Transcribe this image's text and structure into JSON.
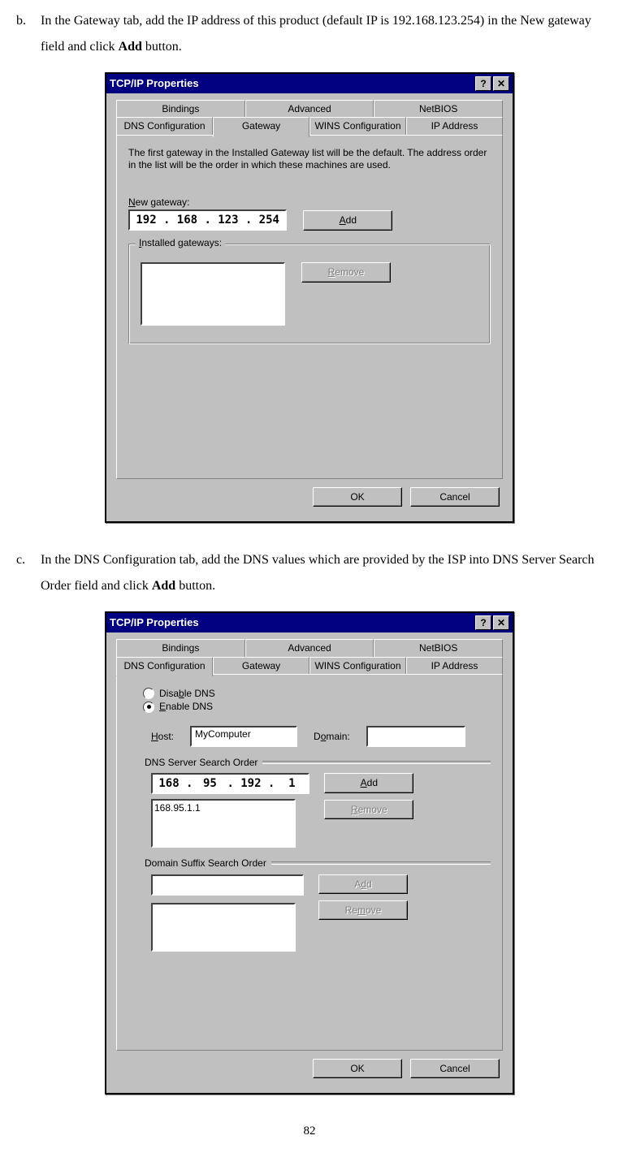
{
  "page_number": "82",
  "instruction_b": {
    "letter": "b.",
    "text_before_bold": "In the Gateway tab, add the IP address of this product (default IP is 192.168.123.254) in the New gateway field and click ",
    "bold": "Add",
    "text_after_bold": " button."
  },
  "instruction_c": {
    "letter": "c.",
    "text_before_bold": "In the DNS Configuration tab, add the DNS values which are provided by the ISP into DNS Server Search Order field and click ",
    "bold": "Add",
    "text_after_bold": " button."
  },
  "dialog1": {
    "title": "TCP/IP Properties",
    "help_btn": "?",
    "close_btn": "✕",
    "tabs_row1": [
      "Bindings",
      "Advanced",
      "NetBIOS"
    ],
    "tabs_row2": [
      "DNS Configuration",
      "Gateway",
      "WINS Configuration",
      "IP Address"
    ],
    "active_tab": "Gateway",
    "help_text": "The first gateway in the Installed Gateway list will be the default. The address order in the list will be the order in which these machines are used.",
    "new_gateway_label": "New gateway:",
    "ip": [
      "192",
      "168",
      "123",
      "254"
    ],
    "add_label": "Add",
    "installed_label": "Installed gateways:",
    "remove_label": "Remove",
    "ok": "OK",
    "cancel": "Cancel"
  },
  "dialog2": {
    "title": "TCP/IP Properties",
    "help_btn": "?",
    "close_btn": "✕",
    "tabs_row1": [
      "Bindings",
      "Advanced",
      "NetBIOS"
    ],
    "tabs_row2": [
      "DNS Configuration",
      "Gateway",
      "WINS Configuration",
      "IP Address"
    ],
    "active_tab": "DNS Configuration",
    "disable_dns": "Disable DNS",
    "enable_dns": "Enable DNS",
    "host_label": "Host:",
    "host_value": "MyComputer",
    "domain_label": "Domain:",
    "domain_value": "",
    "dns_order_label": "DNS Server Search Order",
    "dns_ip": [
      "168",
      "95",
      "192",
      "1"
    ],
    "dns_list_item": "168.95.1.1",
    "domain_suffix_label": "Domain Suffix Search Order",
    "add_label": "Add",
    "remove_label": "Remove",
    "ok": "OK",
    "cancel": "Cancel"
  }
}
